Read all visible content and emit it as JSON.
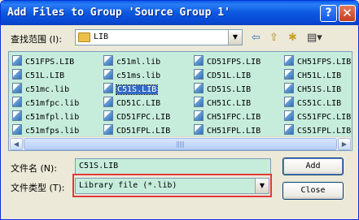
{
  "window": {
    "title": "Add Files to Group 'Source Group 1'",
    "help_label": "?",
    "close_label": "✕"
  },
  "location": {
    "label": "查找范围 (I):",
    "value": "LIB",
    "dropdown_glyph": "▼"
  },
  "toolbar": {
    "back_glyph": "⇦",
    "up_glyph": "⇧",
    "newfolder_glyph": "✱",
    "views_glyph": "▤▾"
  },
  "files": {
    "col1": [
      "C51FPS.LIB",
      "C51L.LIB",
      "c51mc.lib",
      "c51mfpc.lib",
      "c51mfpl.lib",
      "c51mfps.lib"
    ],
    "col2": [
      "c51ml.lib",
      "c51ms.lib",
      "C51S.LIB",
      "CD51C.LIB",
      "CD51FPC.LIB",
      "CD51FPL.LIB"
    ],
    "col3": [
      "CD51FPS.LIB",
      "CD51L.LIB",
      "CD51S.LIB",
      "CH51C.LIB",
      "CH51FPC.LIB",
      "CH51FPL.LIB"
    ],
    "col4": [
      "CH51FPS.LIB",
      "CH51L.LIB",
      "CH51S.LIB",
      "CS51C.LIB",
      "CS51FPC.LIB",
      "CS51FPL.LIB"
    ],
    "selected": "C51S.LIB"
  },
  "scrollbar": {
    "left_glyph": "◀",
    "right_glyph": "▶"
  },
  "filename": {
    "label": "文件名 (N):",
    "value": "C51S.LIB"
  },
  "filetype": {
    "label": "文件类型 (T):",
    "value": "Library file (*.lib)"
  },
  "buttons": {
    "add": "Add",
    "close": "Close"
  }
}
